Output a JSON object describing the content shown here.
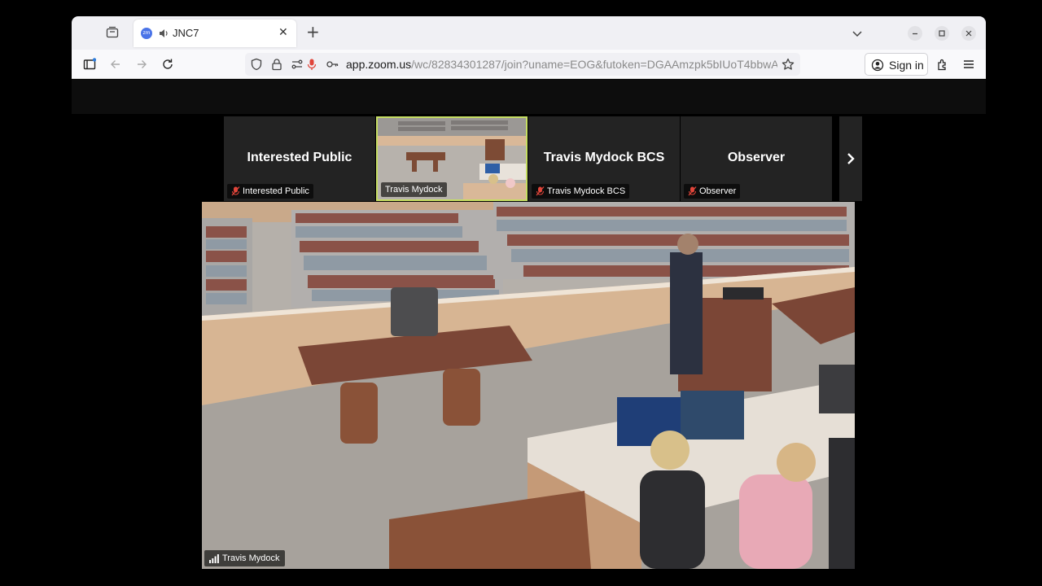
{
  "browser": {
    "tab": {
      "title": "JNC7",
      "favicon": "zm"
    },
    "url": {
      "host": "app.zoom.us",
      "path": "/wc/82834301287/join?uname=EOG&futoken=DGAAmzpk5bIUoT4bbwA"
    },
    "signin_label": "Sign in"
  },
  "meeting": {
    "tiles": [
      {
        "name": "Interested Public",
        "label": "Interested Public",
        "muted": true
      },
      {
        "name": "",
        "label": "Travis Mydock",
        "muted": false
      },
      {
        "name": "Travis Mydock BCS",
        "label": "Travis Mydock BCS",
        "muted": true
      },
      {
        "name": "Observer",
        "label": "Observer",
        "muted": true
      }
    ],
    "main_speaker_label": "Travis Mydock"
  },
  "colors": {
    "active_speaker_border": "#c6de63",
    "muted_icon": "#e0453a",
    "tile_bg": "#232323"
  }
}
